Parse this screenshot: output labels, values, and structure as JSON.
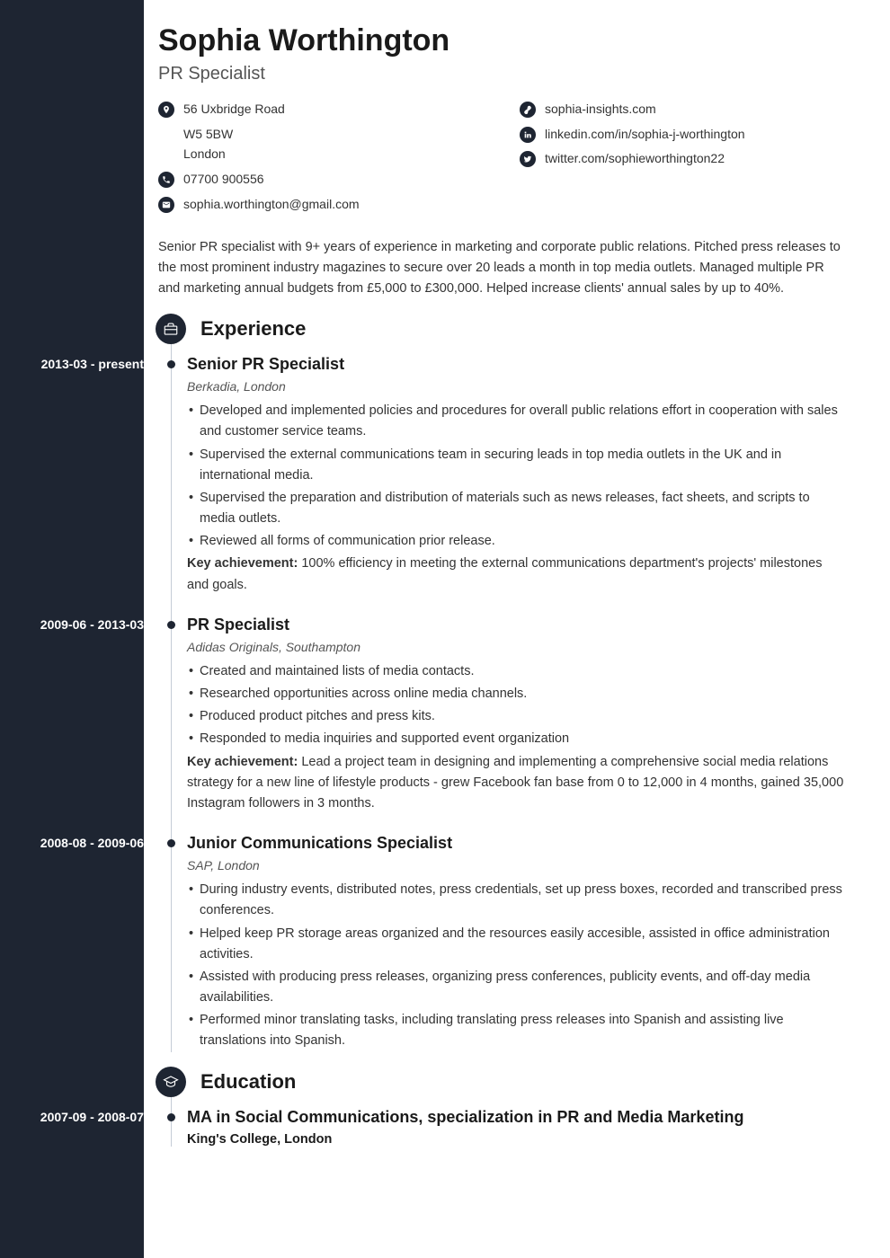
{
  "header": {
    "name": "Sophia Worthington",
    "title": "PR Specialist"
  },
  "contact": {
    "address1": "56 Uxbridge Road",
    "address2": "W5 5BW",
    "address3": "London",
    "phone": "07700 900556",
    "email": "sophia.worthington@gmail.com",
    "website": "sophia-insights.com",
    "linkedin": "linkedin.com/in/sophia-j-worthington",
    "twitter": "twitter.com/sophieworthington22"
  },
  "summary": "Senior PR specialist with 9+ years of experience in marketing and corporate public relations. Pitched press releases to the most prominent industry magazines to secure over 20 leads a month in top media outlets. Managed multiple PR and marketing annual budgets from £5,000 to £300,000. Helped increase clients' annual sales by up to 40%.",
  "sections": {
    "experience": "Experience",
    "education": "Education"
  },
  "experience": [
    {
      "dates": "2013-03 - present",
      "title": "Senior PR Specialist",
      "company": "Berkadia, London",
      "bullets": [
        "Developed and implemented policies and procedures for overall public relations effort in cooperation with sales and customer service teams.",
        "Supervised the external communications team in securing leads in top media outlets in the UK and in international media.",
        "Supervised the preparation and distribution of materials such as news releases, fact sheets, and scripts to media outlets.",
        "Reviewed all forms of communication prior release."
      ],
      "achievement_label": "Key achievement:",
      "achievement": " 100% efficiency in meeting the external communications department's projects' milestones and goals."
    },
    {
      "dates": "2009-06 - 2013-03",
      "title": "PR Specialist",
      "company": "Adidas Originals, Southampton",
      "bullets": [
        "Created and maintained lists of media contacts.",
        "Researched opportunities across online media channels.",
        "Produced product pitches and press kits.",
        "Responded to media inquiries and supported event organization"
      ],
      "achievement_label": "Key achievement:",
      "achievement": " Lead a project team in designing and implementing a comprehensive social media relations strategy for a new line of lifestyle products - grew Facebook fan base from 0 to 12,000 in 4 months, gained 35,000 Instagram followers in 3 months."
    },
    {
      "dates": "2008-08 - 2009-06",
      "title": "Junior Communications Specialist",
      "company": "SAP, London",
      "bullets": [
        "During industry events, distributed notes, press credentials, set up press boxes, recorded and transcribed press conferences.",
        "Helped keep PR storage areas organized and the resources easily accesible, assisted in office administration activities.",
        "Assisted with producing press releases, organizing press conferences, publicity events, and off-day media availabilities.",
        "Performed minor translating tasks, including translating press releases into Spanish and assisting live translations into Spanish."
      ]
    }
  ],
  "education": [
    {
      "dates": "2007-09 - 2008-07",
      "degree": "MA in Social Communications, specialization in PR and Media Marketing",
      "school": "King's College, London"
    }
  ]
}
